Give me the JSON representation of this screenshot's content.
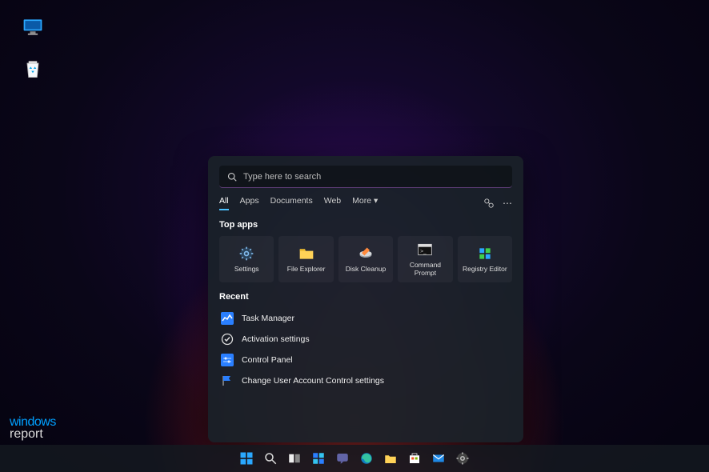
{
  "search": {
    "placeholder": "Type here to search"
  },
  "tabs": {
    "all": "All",
    "apps": "Apps",
    "documents": "Documents",
    "web": "Web",
    "more": "More"
  },
  "sections": {
    "top_apps": "Top apps",
    "recent": "Recent"
  },
  "top_apps": {
    "settings": "Settings",
    "file_explorer": "File Explorer",
    "disk_cleanup": "Disk Cleanup",
    "command_prompt": "Command Prompt",
    "registry_editor": "Registry Editor"
  },
  "recent": {
    "task_manager": "Task Manager",
    "activation": "Activation settings",
    "control_panel": "Control Panel",
    "uac": "Change User Account Control settings"
  },
  "watermark": {
    "line1": "windows",
    "line2": "report"
  }
}
